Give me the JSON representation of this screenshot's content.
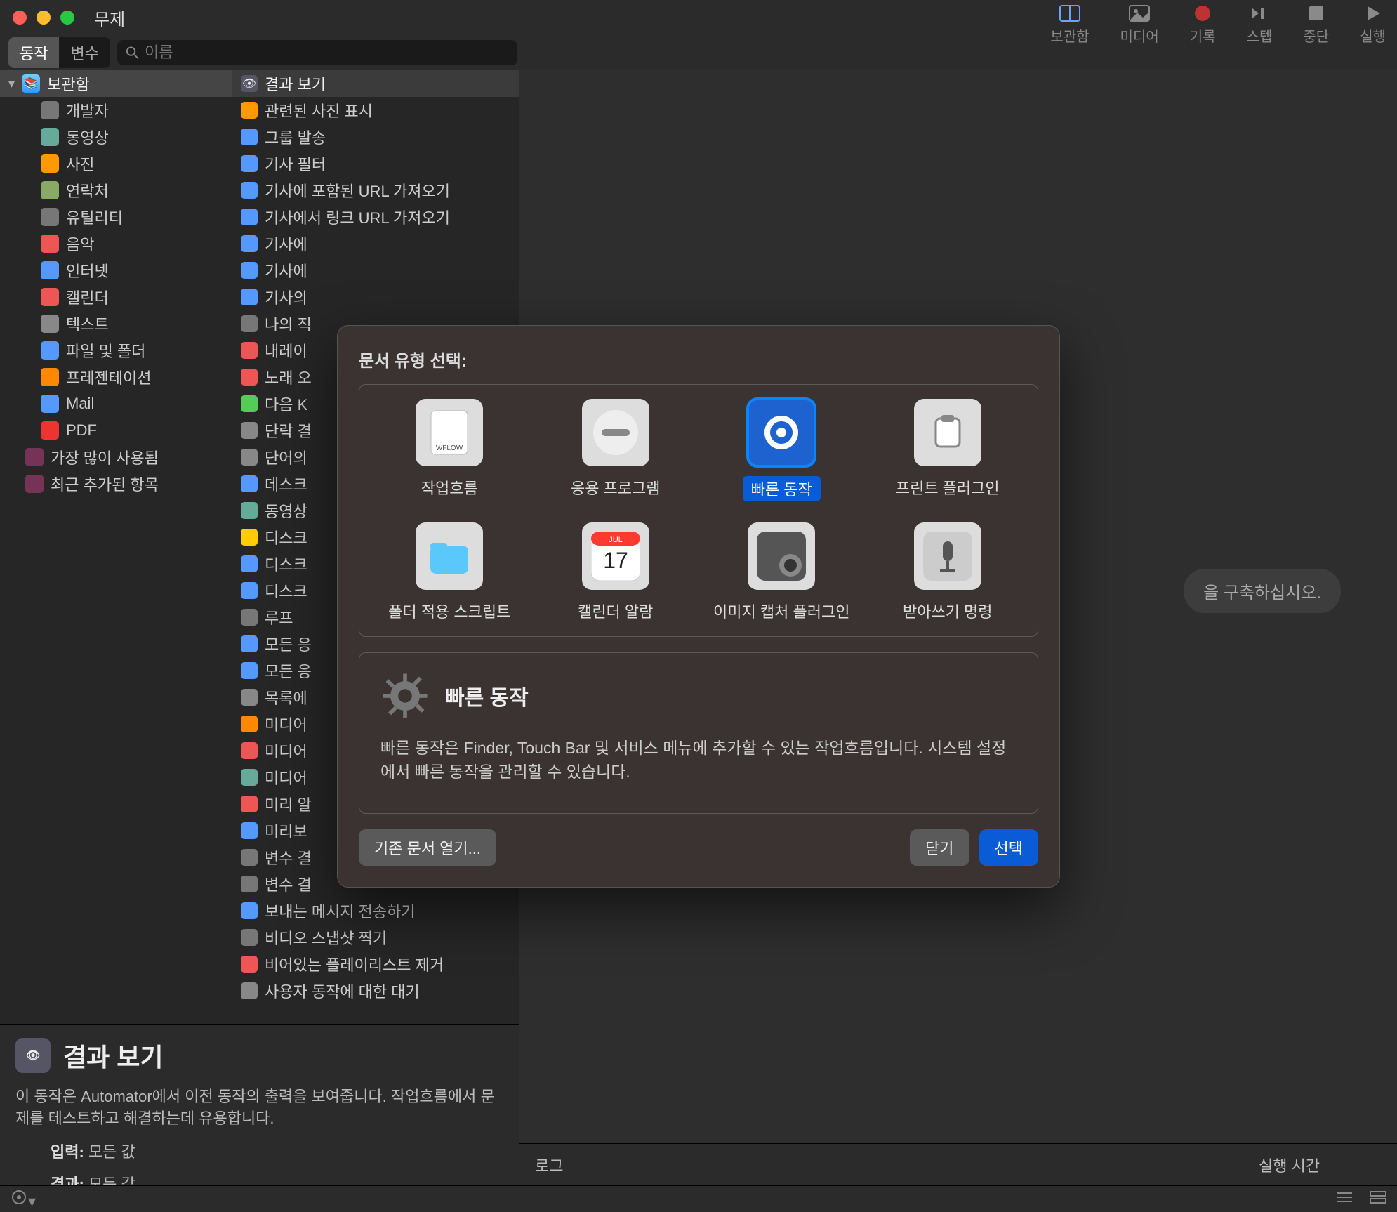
{
  "window": {
    "title": "무제"
  },
  "toolbar": {
    "items": [
      {
        "label": "보관함",
        "icon": "library"
      },
      {
        "label": "미디어",
        "icon": "media"
      },
      {
        "label": "기록",
        "icon": "record"
      },
      {
        "label": "스텝",
        "icon": "step"
      },
      {
        "label": "중단",
        "icon": "stop"
      },
      {
        "label": "실행",
        "icon": "play"
      }
    ]
  },
  "segments": {
    "action": "동작",
    "variable": "변수"
  },
  "search": {
    "placeholder": "이름"
  },
  "library": {
    "header": "보관함",
    "items": [
      "개발자",
      "동영상",
      "사진",
      "연락처",
      "유틸리티",
      "음악",
      "인터넷",
      "캘린더",
      "텍스트",
      "파일 및 폴더",
      "프레젠테이션",
      "Mail",
      "PDF"
    ],
    "footerItems": [
      "가장 많이 사용됨",
      "최근 추가된 항목"
    ]
  },
  "actions": {
    "header": "결과 보기",
    "items": [
      "관련된 사진 표시",
      "그룹 발송",
      "기사 필터",
      "기사에 포함된 URL 가져오기",
      "기사에서 링크 URL 가져오기",
      "기사에",
      "기사에",
      "기사의",
      "나의 직",
      "내레이",
      "노래 오",
      "다음 K",
      "단락 결",
      "단어의",
      "데스크",
      "동영상",
      "디스크",
      "디스크",
      "디스크",
      "루프",
      "모든 응",
      "모든 응",
      "목록에",
      "미디어",
      "미디어",
      "미디어",
      "미리 알",
      "미리보",
      "변수 결",
      "변수 결",
      "보내는 메시지 전송하기",
      "비디오 스냅샷 찍기",
      "비어있는 플레이리스트 제거",
      "사용자 동작에 대한 대기"
    ]
  },
  "canvasHint": "을 구축하십시오.",
  "info": {
    "title": "결과 보기",
    "desc": "이 동작은 Automator에서 이전 동작의 출력을 보여줍니다. 작업흐름에서 문제를 테스트하고 해결하는데 유용합니다.",
    "inputLabel": "입력:",
    "inputValue": "모든 값",
    "resultLabel": "결과:",
    "resultValue": "모든 값"
  },
  "log": {
    "logLabel": "로그",
    "timeLabel": "실행 시간"
  },
  "modal": {
    "heading": "문서 유형 선택:",
    "options": [
      {
        "label": "작업흐름"
      },
      {
        "label": "응용 프로그램"
      },
      {
        "label": "빠른 동작",
        "selected": true
      },
      {
        "label": "프린트 플러그인"
      },
      {
        "label": "폴더 적용 스크립트"
      },
      {
        "label": "캘린더 알람"
      },
      {
        "label": "이미지 캡처 플러그인"
      },
      {
        "label": "받아쓰기 명령"
      }
    ],
    "detailTitle": "빠른 동작",
    "detailBody": "빠른 동작은 Finder, Touch Bar 및 서비스 메뉴에 추가할 수 있는 작업흐름입니다. 시스템 설정에서 빠른 동작을 관리할 수 있습니다.",
    "openExisting": "기존 문서 열기...",
    "close": "닫기",
    "choose": "선택"
  }
}
